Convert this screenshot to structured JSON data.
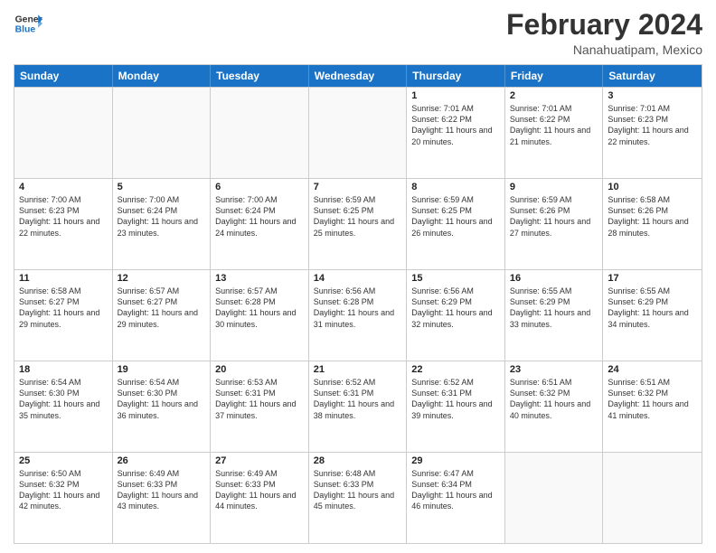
{
  "header": {
    "logo_line1": "General",
    "logo_line2": "Blue",
    "month_title": "February 2024",
    "location": "Nanahuatipam, Mexico"
  },
  "weekdays": [
    "Sunday",
    "Monday",
    "Tuesday",
    "Wednesday",
    "Thursday",
    "Friday",
    "Saturday"
  ],
  "rows": [
    [
      {
        "day": "",
        "info": ""
      },
      {
        "day": "",
        "info": ""
      },
      {
        "day": "",
        "info": ""
      },
      {
        "day": "",
        "info": ""
      },
      {
        "day": "1",
        "info": "Sunrise: 7:01 AM\nSunset: 6:22 PM\nDaylight: 11 hours and 20 minutes."
      },
      {
        "day": "2",
        "info": "Sunrise: 7:01 AM\nSunset: 6:22 PM\nDaylight: 11 hours and 21 minutes."
      },
      {
        "day": "3",
        "info": "Sunrise: 7:01 AM\nSunset: 6:23 PM\nDaylight: 11 hours and 22 minutes."
      }
    ],
    [
      {
        "day": "4",
        "info": "Sunrise: 7:00 AM\nSunset: 6:23 PM\nDaylight: 11 hours and 22 minutes."
      },
      {
        "day": "5",
        "info": "Sunrise: 7:00 AM\nSunset: 6:24 PM\nDaylight: 11 hours and 23 minutes."
      },
      {
        "day": "6",
        "info": "Sunrise: 7:00 AM\nSunset: 6:24 PM\nDaylight: 11 hours and 24 minutes."
      },
      {
        "day": "7",
        "info": "Sunrise: 6:59 AM\nSunset: 6:25 PM\nDaylight: 11 hours and 25 minutes."
      },
      {
        "day": "8",
        "info": "Sunrise: 6:59 AM\nSunset: 6:25 PM\nDaylight: 11 hours and 26 minutes."
      },
      {
        "day": "9",
        "info": "Sunrise: 6:59 AM\nSunset: 6:26 PM\nDaylight: 11 hours and 27 minutes."
      },
      {
        "day": "10",
        "info": "Sunrise: 6:58 AM\nSunset: 6:26 PM\nDaylight: 11 hours and 28 minutes."
      }
    ],
    [
      {
        "day": "11",
        "info": "Sunrise: 6:58 AM\nSunset: 6:27 PM\nDaylight: 11 hours and 29 minutes."
      },
      {
        "day": "12",
        "info": "Sunrise: 6:57 AM\nSunset: 6:27 PM\nDaylight: 11 hours and 29 minutes."
      },
      {
        "day": "13",
        "info": "Sunrise: 6:57 AM\nSunset: 6:28 PM\nDaylight: 11 hours and 30 minutes."
      },
      {
        "day": "14",
        "info": "Sunrise: 6:56 AM\nSunset: 6:28 PM\nDaylight: 11 hours and 31 minutes."
      },
      {
        "day": "15",
        "info": "Sunrise: 6:56 AM\nSunset: 6:29 PM\nDaylight: 11 hours and 32 minutes."
      },
      {
        "day": "16",
        "info": "Sunrise: 6:55 AM\nSunset: 6:29 PM\nDaylight: 11 hours and 33 minutes."
      },
      {
        "day": "17",
        "info": "Sunrise: 6:55 AM\nSunset: 6:29 PM\nDaylight: 11 hours and 34 minutes."
      }
    ],
    [
      {
        "day": "18",
        "info": "Sunrise: 6:54 AM\nSunset: 6:30 PM\nDaylight: 11 hours and 35 minutes."
      },
      {
        "day": "19",
        "info": "Sunrise: 6:54 AM\nSunset: 6:30 PM\nDaylight: 11 hours and 36 minutes."
      },
      {
        "day": "20",
        "info": "Sunrise: 6:53 AM\nSunset: 6:31 PM\nDaylight: 11 hours and 37 minutes."
      },
      {
        "day": "21",
        "info": "Sunrise: 6:52 AM\nSunset: 6:31 PM\nDaylight: 11 hours and 38 minutes."
      },
      {
        "day": "22",
        "info": "Sunrise: 6:52 AM\nSunset: 6:31 PM\nDaylight: 11 hours and 39 minutes."
      },
      {
        "day": "23",
        "info": "Sunrise: 6:51 AM\nSunset: 6:32 PM\nDaylight: 11 hours and 40 minutes."
      },
      {
        "day": "24",
        "info": "Sunrise: 6:51 AM\nSunset: 6:32 PM\nDaylight: 11 hours and 41 minutes."
      }
    ],
    [
      {
        "day": "25",
        "info": "Sunrise: 6:50 AM\nSunset: 6:32 PM\nDaylight: 11 hours and 42 minutes."
      },
      {
        "day": "26",
        "info": "Sunrise: 6:49 AM\nSunset: 6:33 PM\nDaylight: 11 hours and 43 minutes."
      },
      {
        "day": "27",
        "info": "Sunrise: 6:49 AM\nSunset: 6:33 PM\nDaylight: 11 hours and 44 minutes."
      },
      {
        "day": "28",
        "info": "Sunrise: 6:48 AM\nSunset: 6:33 PM\nDaylight: 11 hours and 45 minutes."
      },
      {
        "day": "29",
        "info": "Sunrise: 6:47 AM\nSunset: 6:34 PM\nDaylight: 11 hours and 46 minutes."
      },
      {
        "day": "",
        "info": ""
      },
      {
        "day": "",
        "info": ""
      }
    ]
  ]
}
